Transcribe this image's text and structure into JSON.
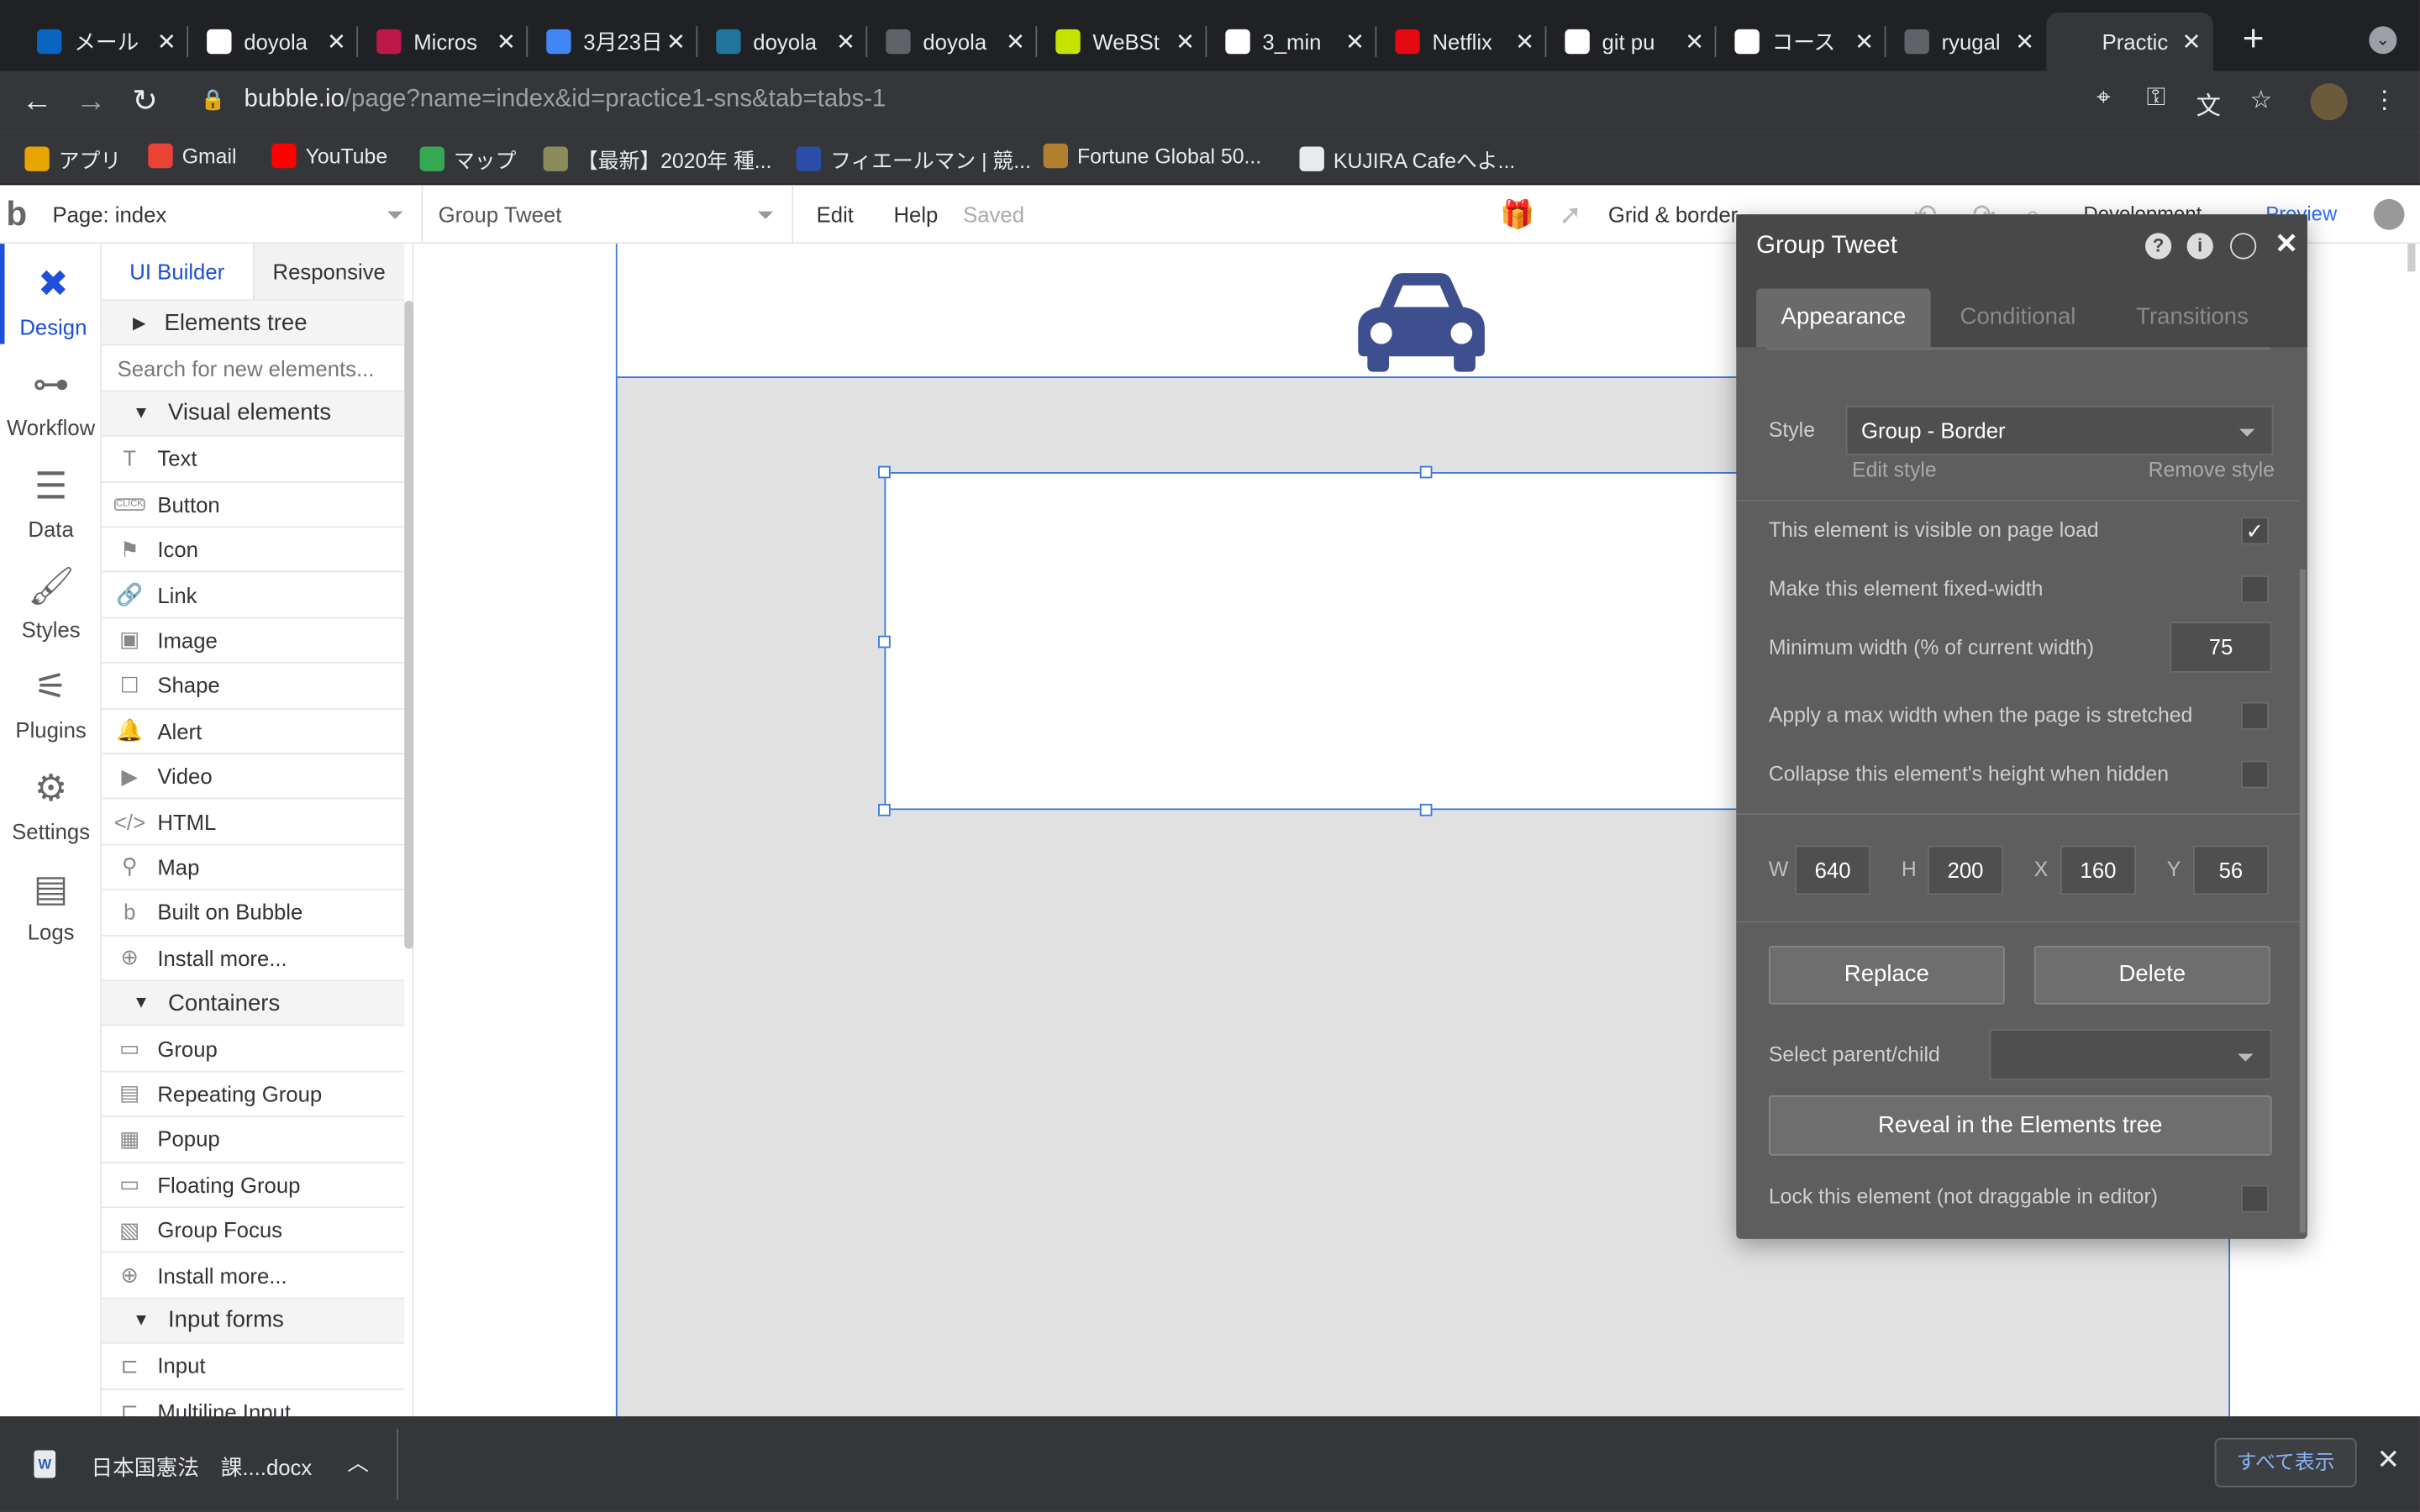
{
  "browser": {
    "tabs": [
      {
        "title": "メール",
        "icon": "outlook-icon",
        "color": "#0a64c2"
      },
      {
        "title": "doyola",
        "icon": "github-icon",
        "color": "#ffffff"
      },
      {
        "title": "Micros",
        "icon": "stream-icon",
        "color": "#bc1948"
      },
      {
        "title": "3月23日",
        "icon": "docs-icon",
        "color": "#4285f4"
      },
      {
        "title": "doyola",
        "icon": "wordpress-icon",
        "color": "#21759b"
      },
      {
        "title": "doyola",
        "icon": "globe-icon",
        "color": "#5f6368"
      },
      {
        "title": "WeBSt",
        "icon": "lime-icon",
        "color": "#c6e300"
      },
      {
        "title": "3_min",
        "icon": "dl-icon",
        "color": "#ffffff"
      },
      {
        "title": "Netflix",
        "icon": "netflix-icon",
        "color": "#e50914"
      },
      {
        "title": "git pu",
        "icon": "h-icon",
        "color": "#ffffff"
      },
      {
        "title": "コース",
        "icon": "course-icon",
        "color": "#ffffff"
      },
      {
        "title": "ryugal",
        "icon": "globe-icon",
        "color": "#5f6368"
      },
      {
        "title": "Practic",
        "icon": "bubble-icon",
        "color": "#35363a"
      }
    ],
    "url_host": "bubble.io",
    "url_path": "/page?name=index&id=practice1-sns&tab=tabs-1",
    "bookmarks": [
      {
        "label": "アプリ",
        "icon": "apps-icon"
      },
      {
        "label": "Gmail",
        "icon": "google-icon"
      },
      {
        "label": "YouTube",
        "icon": "youtube-icon"
      },
      {
        "label": "マップ",
        "icon": "maps-icon"
      },
      {
        "label": "【最新】2020年 種...",
        "icon": "bookmark-icon"
      },
      {
        "label": "フィエールマン | 競...",
        "icon": "bookmark-icon"
      },
      {
        "label": "Fortune Global 50...",
        "icon": "bookmark-icon"
      },
      {
        "label": "KUJIRA Cafeへよ...",
        "icon": "bookmark-icon"
      }
    ]
  },
  "editor": {
    "page_selector": "Page: index",
    "element_selector": "Group Tweet",
    "menu": {
      "edit": "Edit",
      "help": "Help",
      "saved": "Saved"
    },
    "grid_label": "Grid & border",
    "development": "Development",
    "preview": "Preview"
  },
  "left_nav": [
    {
      "label": "Design",
      "icon": "design-icon",
      "active": true
    },
    {
      "label": "Workflow",
      "icon": "workflow-icon"
    },
    {
      "label": "Data",
      "icon": "database-icon"
    },
    {
      "label": "Styles",
      "icon": "brush-icon"
    },
    {
      "label": "Plugins",
      "icon": "plug-icon"
    },
    {
      "label": "Settings",
      "icon": "gear-icon"
    },
    {
      "label": "Logs",
      "icon": "logs-icon"
    }
  ],
  "palette": {
    "tabs": {
      "ui_builder": "UI Builder",
      "responsive": "Responsive"
    },
    "elements_tree": "Elements tree",
    "search_placeholder": "Search for new elements...",
    "sections": {
      "visual": "Visual elements",
      "containers": "Containers",
      "inputs": "Input forms"
    },
    "visual_items": [
      {
        "label": "Text",
        "icon": "T"
      },
      {
        "label": "Button",
        "icon": "CLICK"
      },
      {
        "label": "Icon",
        "icon": "⚑"
      },
      {
        "label": "Link",
        "icon": "🔗"
      },
      {
        "label": "Image",
        "icon": "▣"
      },
      {
        "label": "Shape",
        "icon": "☐"
      },
      {
        "label": "Alert",
        "icon": "🔔"
      },
      {
        "label": "Video",
        "icon": "▶"
      },
      {
        "label": "HTML",
        "icon": "</>"
      },
      {
        "label": "Map",
        "icon": "⚲"
      },
      {
        "label": "Built on Bubble",
        "icon": "b"
      },
      {
        "label": "Install more...",
        "icon": "⊕"
      }
    ],
    "container_items": [
      {
        "label": "Group",
        "icon": "▭"
      },
      {
        "label": "Repeating Group",
        "icon": "▤"
      },
      {
        "label": "Popup",
        "icon": "▦"
      },
      {
        "label": "Floating Group",
        "icon": "▭"
      },
      {
        "label": "Group Focus",
        "icon": "▧"
      },
      {
        "label": "Install more...",
        "icon": "⊕"
      }
    ],
    "input_items": [
      {
        "label": "Input",
        "icon": "⊏"
      },
      {
        "label": "Multiline Input",
        "icon": "⊏"
      }
    ]
  },
  "property_editor": {
    "title": "Group Tweet",
    "tabs": {
      "appearance": "Appearance",
      "conditional": "Conditional",
      "transitions": "Transitions"
    },
    "style_label": "Style",
    "style_value": "Group - Border",
    "edit_style": "Edit style",
    "remove_style": "Remove style",
    "visible_label": "This element is visible on page load",
    "visible_checked": true,
    "fixed_width_label": "Make this element fixed-width",
    "min_width_label": "Minimum width (% of current width)",
    "min_width_value": "75",
    "max_width_label": "Apply a max width when the page is stretched",
    "collapse_label": "Collapse this element's height when hidden",
    "dims": {
      "w_label": "W",
      "w": "640",
      "h_label": "H",
      "h": "200",
      "x_label": "X",
      "x": "160",
      "y_label": "Y",
      "y": "56"
    },
    "replace": "Replace",
    "delete": "Delete",
    "parent_child_label": "Select parent/child",
    "reveal": "Reveal in the Elements tree",
    "lock_label": "Lock this element (not draggable in editor)"
  },
  "download_bar": {
    "filename": "日本国憲法　課....docx",
    "show_all": "すべて表示"
  },
  "colors": {
    "accent": "#1d4fd8",
    "selection": "#3b78d8",
    "car_icon": "#3e4f8f"
  }
}
